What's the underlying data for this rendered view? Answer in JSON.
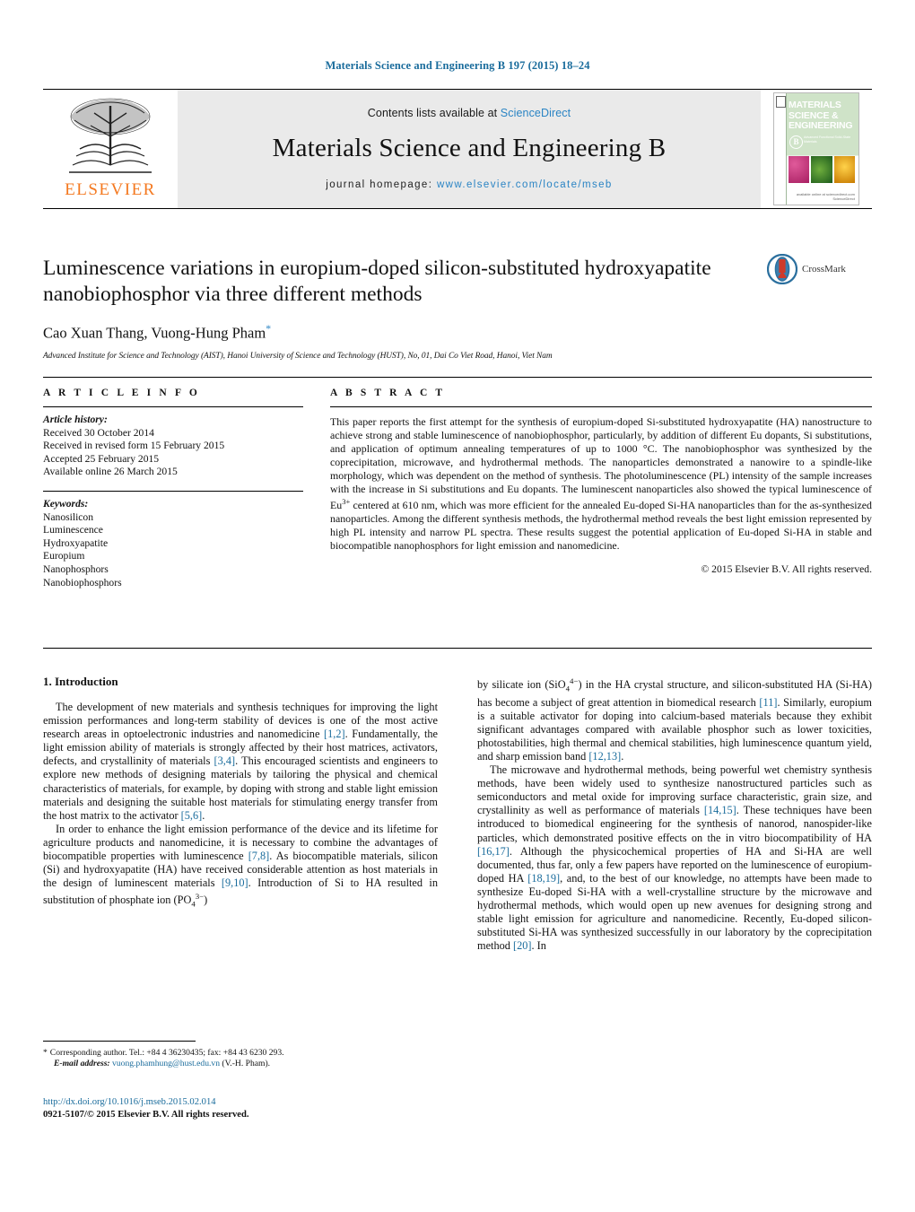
{
  "running_head": "Materials Science and Engineering B 197 (2015) 18–24",
  "banner": {
    "publisher_word": "ELSEVIER",
    "contents_prefix": "Contents lists available at ",
    "contents_link": "ScienceDirect",
    "journal_title": "Materials Science and Engineering B",
    "homepage_prefix": "journal homepage:",
    "homepage_url": "www.elsevier.com/locate/mseb",
    "cover": {
      "line1": "MATERIALS",
      "line2": "SCIENCE &",
      "line3": "ENGINEERING",
      "badge": "B",
      "badge_sub": "Advanced Functional Solid-State Materials",
      "footer": "available online at sciencedirect.com  ScienceDirect"
    }
  },
  "article": {
    "title": "Luminescence variations in europium-doped silicon-substituted hydroxyapatite nanobiophosphor via three different methods",
    "authors": "Cao Xuan Thang, Vuong-Hung Pham",
    "author_star": "*",
    "affiliation": "Advanced Institute for Science and Technology (AIST), Hanoi University of Science and Technology (HUST), No, 01, Dai Co Viet Road, Hanoi, Viet Nam",
    "crossmark_label": "CrossMark"
  },
  "info": {
    "heading": "A R T I C L E   I N F O",
    "history_label": "Article history:",
    "history": [
      "Received 30 October 2014",
      "Received in revised form 15 February 2015",
      "Accepted 25 February 2015",
      "Available online 26 March 2015"
    ],
    "keywords_label": "Keywords:",
    "keywords": [
      "Nanosilicon",
      "Luminescence",
      "Hydroxyapatite",
      "Europium",
      "Nanophosphors",
      "Nanobiophosphors"
    ]
  },
  "abstract": {
    "heading": "A B S T R A C T",
    "text": "This paper reports the first attempt for the synthesis of europium-doped Si-substituted hydroxyapatite (HA) nanostructure to achieve strong and stable luminescence of nanobiophosphor, particularly, by addition of different Eu dopants, Si substitutions, and application of optimum annealing temperatures of up to 1000 °C. The nanobiophosphor was synthesized by the coprecipitation, microwave, and hydrothermal methods. The nanoparticles demonstrated a nanowire to a spindle-like morphology, which was dependent on the method of synthesis. The photoluminescence (PL) intensity of the sample increases with the increase in Si substitutions and Eu dopants. The luminescent nanoparticles also showed the typical luminescence of Eu3+ centered at 610 nm, which was more efficient for the annealed Eu-doped Si-HA nanoparticles than for the as-synthesized nanoparticles. Among the different synthesis methods, the hydrothermal method reveals the best light emission represented by high PL intensity and narrow PL spectra. These results suggest the potential application of Eu-doped Si-HA in stable and biocompatible nanophosphors for light emission and nanomedicine.",
    "copyright": "© 2015 Elsevier B.V. All rights reserved."
  },
  "body": {
    "section_number_title": "1.  Introduction",
    "left_paragraphs": [
      "The development of new materials and synthesis techniques for improving the light emission performances and long-term stability of devices is one of the most active research areas in optoelectronic industries and nanomedicine [1,2]. Fundamentally, the light emission ability of materials is strongly affected by their host matrices, activators, defects, and crystallinity of materials [3,4]. This encouraged scientists and engineers to explore new methods of designing materials by tailoring the physical and chemical characteristics of materials, for example, by doping with strong and stable light emission materials and designing the suitable host materials for stimulating energy transfer from the host matrix to the activator [5,6].",
      "In order to enhance the light emission performance of the device and its lifetime for agriculture products and nanomedicine, it is necessary to combine the advantages of biocompatible properties with luminescence [7,8]. As biocompatible materials, silicon (Si) and hydroxyapatite (HA) have received considerable attention as host materials in the design of luminescent materials [9,10]. Introduction of Si to HA resulted in substitution of phosphate ion (PO43−)"
    ],
    "right_paragraphs": [
      "by silicate ion (SiO44−) in the HA crystal structure, and silicon-substituted HA (Si-HA) has become a subject of great attention in biomedical research [11]. Similarly, europium is a suitable activator for doping into calcium-based materials because they exhibit significant advantages compared with available phosphor such as lower toxicities, photostabilities, high thermal and chemical stabilities, high luminescence quantum yield, and sharp emission band [12,13].",
      "The microwave and hydrothermal methods, being powerful wet chemistry synthesis methods, have been widely used to synthesize nanostructured particles such as semiconductors and metal oxide for improving surface characteristic, grain size, and crystallinity as well as performance of materials [14,15]. These techniques have been introduced to biomedical engineering for the synthesis of nanorod, nanospider-like particles, which demonstrated positive effects on the in vitro biocompatibility of HA [16,17]. Although the physicochemical properties of HA and Si-HA are well documented, thus far, only a few papers have reported on the luminescence of europium-doped HA [18,19], and, to the best of our knowledge, no attempts have been made to synthesize Eu-doped Si-HA with a well-crystalline structure by the microwave and hydrothermal methods, which would open up new avenues for designing strong and stable light emission for agriculture and nanomedicine. Recently, Eu-doped silicon-substituted Si-HA was synthesized successfully in our laboratory by the coprecipitation method [20]. In"
    ]
  },
  "footnote": {
    "star": "*",
    "corresponding": "Corresponding author. Tel.: +84 4 36230435; fax: +84 43 6230 293.",
    "email_label": "E-mail address:",
    "email": "vuong.phamhung@hust.edu.vn",
    "email_suffix": "(V.-H. Pham).",
    "doi": "http://dx.doi.org/10.1016/j.mseb.2015.02.014",
    "issn_line": "0921-5107/© 2015 Elsevier B.V. All rights reserved."
  },
  "colors": {
    "link": "#1a6c9c",
    "sciencedirect": "#2a84c4",
    "elsevier_orange": "#f47920",
    "banner_bg": "#eaeaea"
  }
}
